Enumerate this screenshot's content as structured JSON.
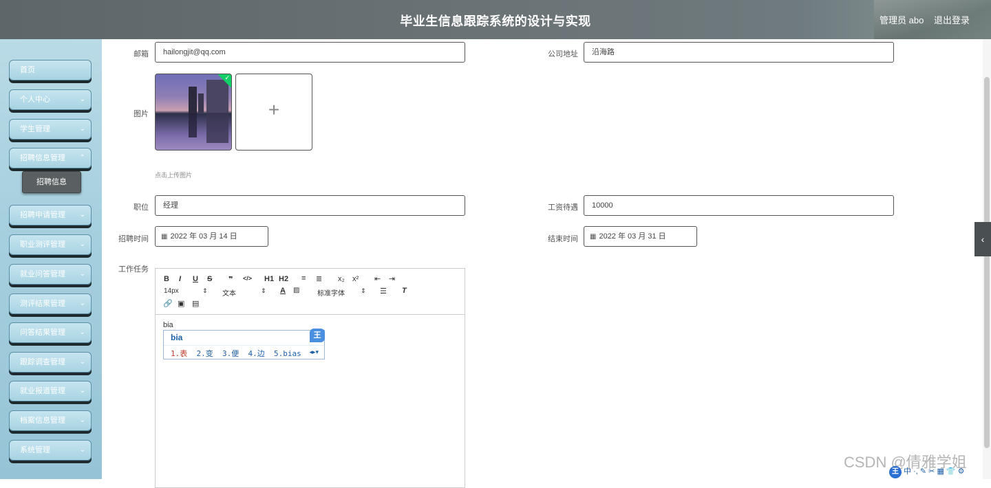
{
  "header": {
    "title": "毕业生信息跟踪系统的设计与实现",
    "user": "管理员 abo",
    "logout": "退出登录"
  },
  "sidebar": {
    "items": [
      {
        "label": "首页",
        "has_chevron": false
      },
      {
        "label": "个人中心",
        "has_chevron": true
      },
      {
        "label": "学生管理",
        "has_chevron": true
      },
      {
        "label": "招聘信息管理",
        "has_chevron": true
      },
      {
        "label": "招聘申请管理",
        "has_chevron": true
      },
      {
        "label": "职业测评管理",
        "has_chevron": true
      },
      {
        "label": "就业问答管理",
        "has_chevron": true
      },
      {
        "label": "测评结果管理",
        "has_chevron": true
      },
      {
        "label": "问答结果管理",
        "has_chevron": true
      },
      {
        "label": "跟踪调查管理",
        "has_chevron": true
      },
      {
        "label": "就业报道管理",
        "has_chevron": true
      },
      {
        "label": "档案信息管理",
        "has_chevron": true
      },
      {
        "label": "系统管理",
        "has_chevron": true
      }
    ],
    "active_sub": "招聘信息"
  },
  "form": {
    "email_label": "邮箱",
    "email_value": "hailongjit@qq.com",
    "address_label": "公司地址",
    "address_value": "沿海路",
    "image_label": "图片",
    "upload_plus": "+",
    "upload_hint": "点击上传图片",
    "position_label": "职位",
    "position_value": "经理",
    "salary_label": "工资待遇",
    "salary_value": "10000",
    "recruit_time_label": "招聘时间",
    "recruit_time_value": "2022 年 03 月 14 日",
    "end_time_label": "结束时间",
    "end_time_value": "2022 年 03 月 31 日",
    "task_label": "工作任务"
  },
  "editor": {
    "toolbar_row1": [
      "B",
      "I",
      "U",
      "S",
      "❞",
      "</>",
      "H1",
      "H2",
      "≡",
      "≣",
      "x₂",
      "x²",
      "⇤",
      "⇥"
    ],
    "font_size": "14px",
    "text_style": "文本",
    "font_family": "标准字体",
    "content": "bia",
    "ime": {
      "pinyin": "bia",
      "candidates": [
        "1.表",
        "2.变",
        "3.便",
        "4.边",
        "5.bias"
      ],
      "logo": "王"
    }
  },
  "watermark": "CSDN @倩雅学姐",
  "tray": {
    "logo": "王",
    "text": "中 ·, ✎ ✂ ▦ 👕 ⚙"
  },
  "colors": {
    "header_bg": "#6b7477",
    "sidebar_bg": "#a7d0df",
    "active_sub_bg": "#5a5f61",
    "ime_text": "#1e5fa8",
    "check_green": "#13ce66"
  }
}
